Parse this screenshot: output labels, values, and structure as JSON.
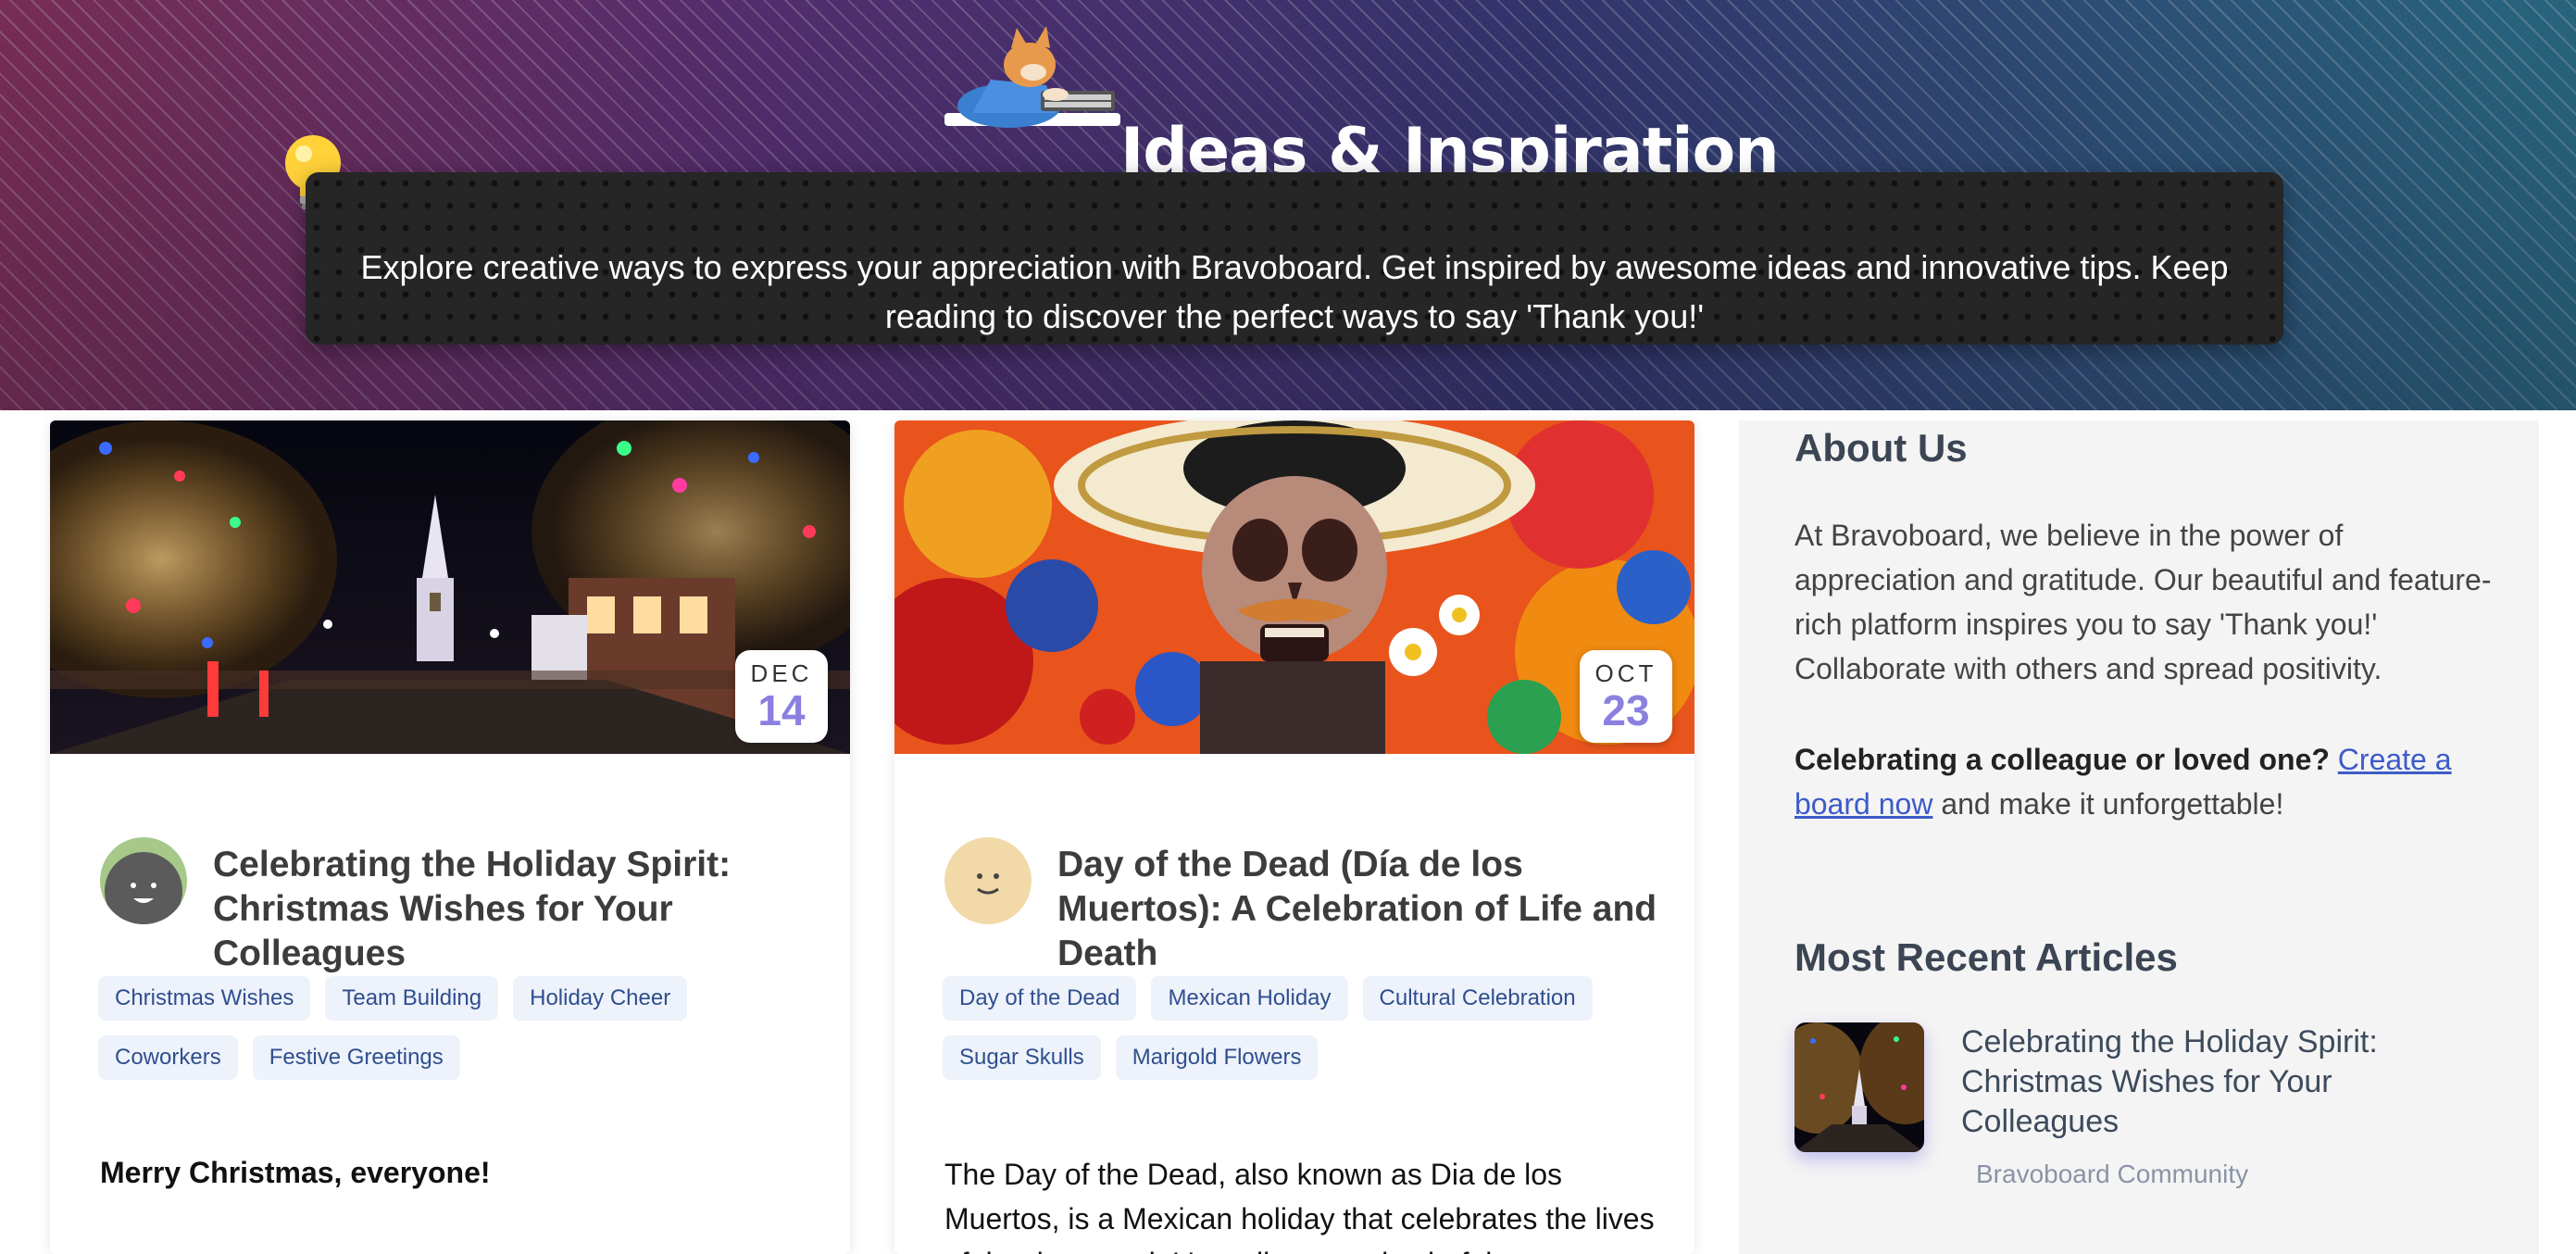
{
  "hero": {
    "title": "Ideas & Inspiration",
    "description": "Explore creative ways to express your appreciation with Bravoboard. Get inspired by awesome ideas and innovative tips. Keep reading to discover the perfect ways to say 'Thank you!'"
  },
  "cards": [
    {
      "date_month": "DEC",
      "date_day": "14",
      "title": "Celebrating the Holiday Spirit: Christmas Wishes for Your Colleagues",
      "tags": [
        "Christmas Wishes",
        "Team Building",
        "Holiday Cheer",
        "Coworkers",
        "Festive Greetings"
      ],
      "excerpt": "Merry Christmas, everyone!"
    },
    {
      "date_month": "OCT",
      "date_day": "23",
      "title": "Day of the Dead (Día de los Muertos): A Celebration of Life and Death",
      "tags": [
        "Day of the Dead",
        "Mexican Holiday",
        "Cultural Celebration",
        "Sugar Skulls",
        "Marigold Flowers"
      ],
      "excerpt": "The Day of the Dead, also known as Dia de los Muertos, is a Mexican holiday that celebrates the lives of the deceased. It's a vibrant and colorful"
    }
  ],
  "sidebar": {
    "about_heading": "About Us",
    "about_text": "At Bravoboard, we believe in the power of appreciation and gratitude. Our beautiful and feature-rich platform inspires you to say 'Thank you!' Collaborate with others and spread positivity.",
    "celebrate_bold": "Celebrating a colleague or loved one?",
    "celebrate_link": "Create a board now",
    "celebrate_rest": "and make it unforgettable!",
    "recent_heading": "Most Recent Articles",
    "recent": [
      {
        "title": "Celebrating the Holiday Spirit: Christmas Wishes for Your Colleagues",
        "author": "Bravoboard Community"
      }
    ]
  },
  "colors": {
    "accent_date": "#8b80e0",
    "tag_bg": "#eef2fa",
    "tag_text": "#2f4f8f",
    "link": "#3d5bc9"
  }
}
